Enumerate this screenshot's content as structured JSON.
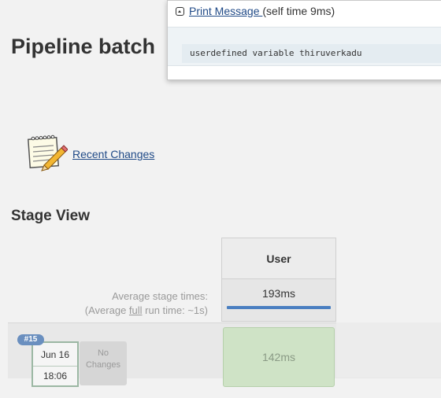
{
  "page": {
    "title": "Pipeline batch"
  },
  "links": {
    "recent_changes": "Recent Changes"
  },
  "stage_view": {
    "title": "Stage View",
    "columns": [
      "User"
    ],
    "average_label_line1": "Average stage times:",
    "average_label_line2_prefix": "(Average ",
    "average_label_line2_underlined": "full",
    "average_label_line2_suffix": " run time: ~1s)",
    "average_times": [
      "193ms"
    ],
    "runs": [
      {
        "badge": "#15",
        "date": "Jun 16",
        "time": "18:06",
        "changes": "No Changes",
        "stage_times": [
          "142ms"
        ]
      }
    ]
  },
  "log_popup": {
    "step_link": "Print Message ",
    "self_time": "(self time 9ms)",
    "log_lines": [
      "userdefined variable thiruverkadu"
    ]
  },
  "colors": {
    "background": "#f2f2f2",
    "link": "#204a87",
    "success_cell": "#cfe3c6",
    "progress_bar": "#4a7fc1",
    "badge": "#6a8fbf"
  }
}
